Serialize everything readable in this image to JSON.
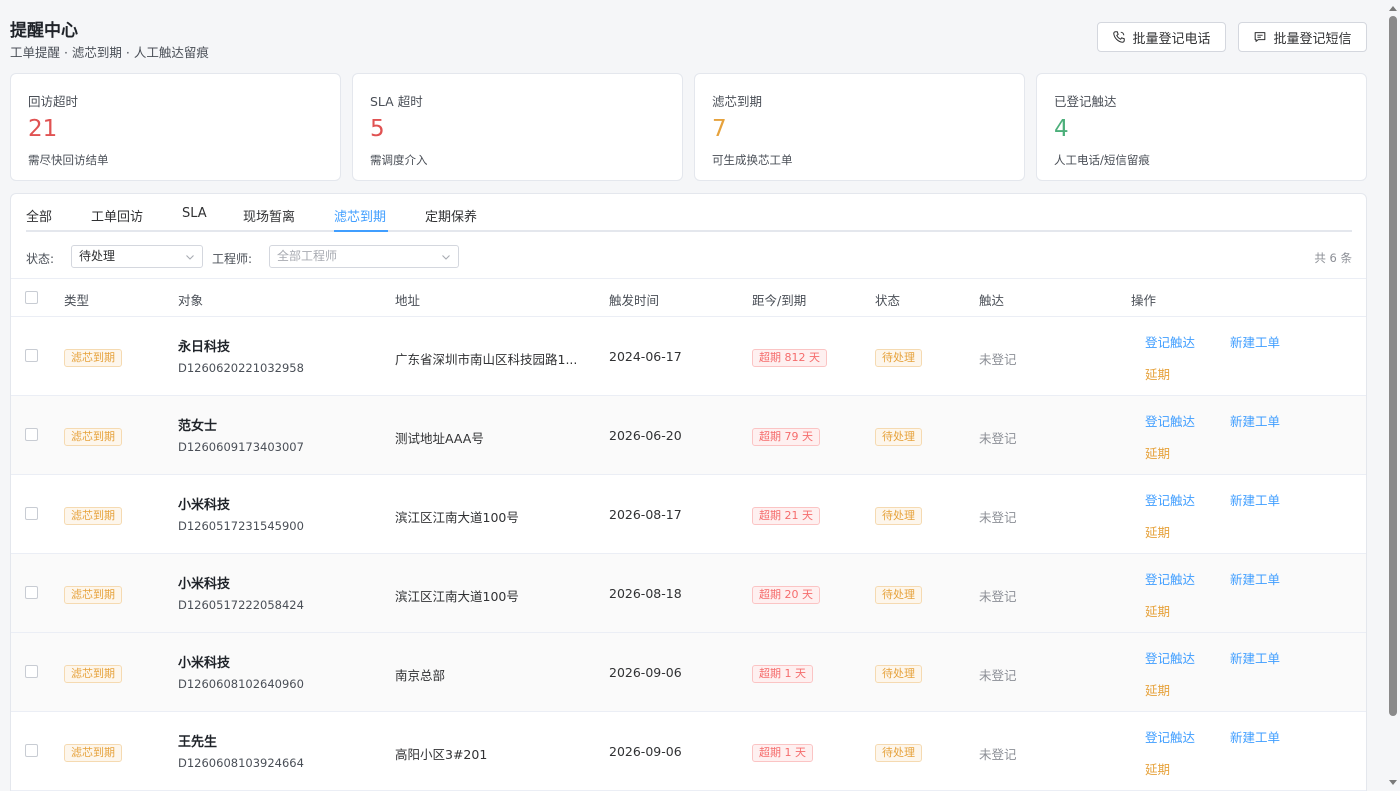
{
  "header": {
    "title": "提醒中心",
    "subtitle": "工单提醒 · 滤芯到期 · 人工触达留痕",
    "btn_phone": "批量登记电话",
    "btn_sms": "批量登记短信"
  },
  "cards": [
    {
      "label": "回访超时",
      "value": "21",
      "desc": "需尽快回访结单",
      "color": "#e05252"
    },
    {
      "label": "SLA 超时",
      "value": "5",
      "desc": "需调度介入",
      "color": "#e05252"
    },
    {
      "label": "滤芯到期",
      "value": "7",
      "desc": "可生成换芯工单",
      "color": "#e6a23c"
    },
    {
      "label": "已登记触达",
      "value": "4",
      "desc": "人工电话/短信留痕",
      "color": "#4caf7a"
    }
  ],
  "tabs": [
    "全部",
    "工单回访",
    "SLA",
    "现场暂离",
    "滤芯到期",
    "定期保养"
  ],
  "active_tab": "滤芯到期",
  "filters": {
    "status_label": "状态:",
    "status_value": "待处理",
    "engineer_label": "工程师:",
    "engineer_placeholder": "全部工程师",
    "count_text": "共 6 条"
  },
  "table": {
    "columns": [
      "类型",
      "对象",
      "地址",
      "触发时间",
      "距今/到期",
      "状态",
      "触达",
      "操作"
    ],
    "actions": {
      "register": "登记触达",
      "new_order": "新建工单",
      "extend": "延期"
    },
    "rows": [
      {
        "type": "滤芯到期",
        "name": "永日科技",
        "id": "D1260620221032958",
        "address": "广东省深圳市南山区科技园路1...",
        "time": "2024-06-17",
        "overdue": "超期 812 天",
        "status": "待处理",
        "reach": "未登记"
      },
      {
        "type": "滤芯到期",
        "name": "范女士",
        "id": "D1260609173403007",
        "address": "测试地址AAA号",
        "time": "2026-06-20",
        "overdue": "超期 79 天",
        "status": "待处理",
        "reach": "未登记"
      },
      {
        "type": "滤芯到期",
        "name": "小米科技",
        "id": "D1260517231545900",
        "address": "滨江区江南大道100号",
        "time": "2026-08-17",
        "overdue": "超期 21 天",
        "status": "待处理",
        "reach": "未登记"
      },
      {
        "type": "滤芯到期",
        "name": "小米科技",
        "id": "D1260517222058424",
        "address": "滨江区江南大道100号",
        "time": "2026-08-18",
        "overdue": "超期 20 天",
        "status": "待处理",
        "reach": "未登记"
      },
      {
        "type": "滤芯到期",
        "name": "小米科技",
        "id": "D1260608102640960",
        "address": "南京总部",
        "time": "2026-09-06",
        "overdue": "超期 1 天",
        "status": "待处理",
        "reach": "未登记"
      },
      {
        "type": "滤芯到期",
        "name": "王先生",
        "id": "D1260608103924664",
        "address": "高阳小区3#201",
        "time": "2026-09-06",
        "overdue": "超期 1 天",
        "status": "待处理",
        "reach": "未登记"
      }
    ]
  }
}
